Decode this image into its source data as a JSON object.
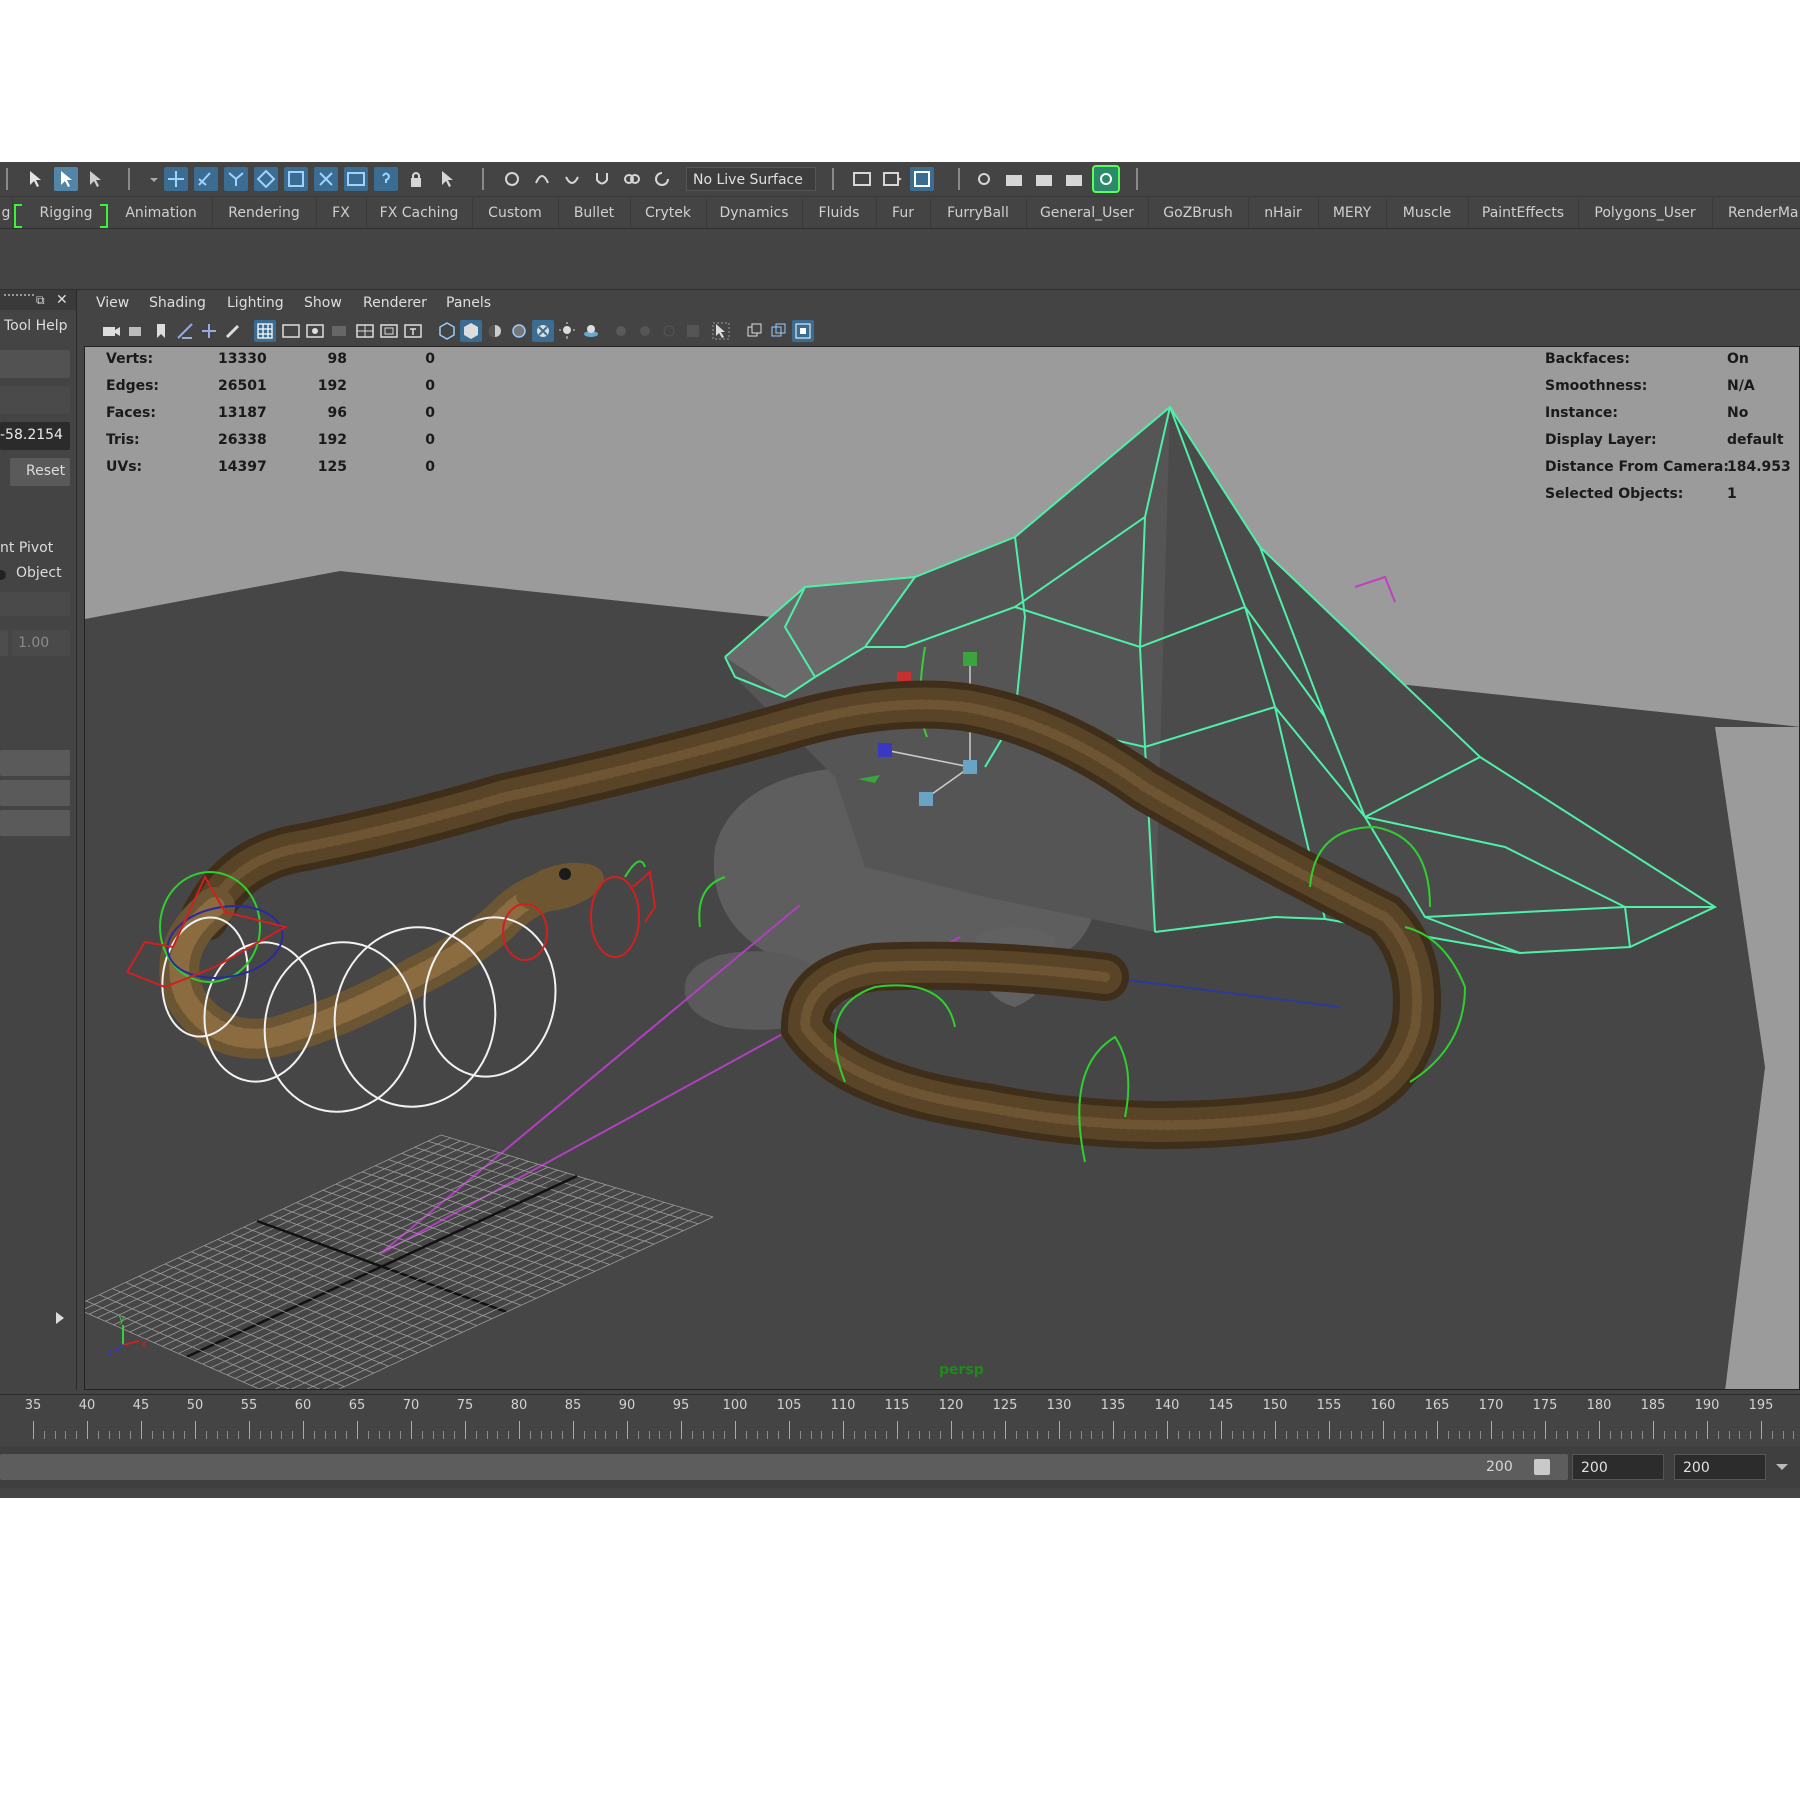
{
  "toolbar": {
    "live_surface_label": "No Live Surface"
  },
  "shelf": {
    "tabs": [
      "g",
      "Rigging",
      "Animation",
      "Rendering",
      "FX",
      "FX Caching",
      "Custom",
      "Bullet",
      "Crytek",
      "Dynamics",
      "Fluids",
      "Fur",
      "FurryBall",
      "General_User",
      "GoZBrush",
      "nHair",
      "MERY",
      "Muscle",
      "PaintEffects",
      "Polygons_User",
      "RenderMa"
    ],
    "active_tab": "Rigging"
  },
  "left_panel": {
    "header_label": "Tool Help",
    "coord_value": "-58.2154",
    "reset_label": "Reset",
    "pivot_label": "nt Pivot",
    "object_option_label": "Object",
    "weight_value": "1.00"
  },
  "viewport": {
    "menu": [
      "View",
      "Shading",
      "Lighting",
      "Show",
      "Renderer",
      "Panels"
    ],
    "camera_label": "persp",
    "hud_left": [
      {
        "label": "Verts:",
        "values": [
          "13330",
          "98",
          "0"
        ]
      },
      {
        "label": "Edges:",
        "values": [
          "26501",
          "192",
          "0"
        ]
      },
      {
        "label": "Faces:",
        "values": [
          "13187",
          "96",
          "0"
        ]
      },
      {
        "label": "Tris:",
        "values": [
          "26338",
          "192",
          "0"
        ]
      },
      {
        "label": "UVs:",
        "values": [
          "14397",
          "125",
          "0"
        ]
      }
    ],
    "hud_right": [
      {
        "label": "Backfaces:",
        "value": "On"
      },
      {
        "label": "Smoothness:",
        "value": "N/A"
      },
      {
        "label": "Instance:",
        "value": "No"
      },
      {
        "label": "Display Layer:",
        "value": "default"
      },
      {
        "label": "Distance From Camera:",
        "value": "184.953"
      },
      {
        "label": "Selected Objects:",
        "value": "1"
      }
    ],
    "axis_labels": {
      "y": "y",
      "z": "z",
      "x": "x"
    }
  },
  "timeline": {
    "ticks": [
      "35",
      "40",
      "45",
      "50",
      "55",
      "60",
      "65",
      "70",
      "75",
      "80",
      "85",
      "90",
      "95",
      "100",
      "105",
      "110",
      "115",
      "120",
      "125",
      "130",
      "135",
      "140",
      "145",
      "150",
      "155",
      "160",
      "165",
      "170",
      "175",
      "180",
      "185",
      "190",
      "195"
    ]
  },
  "range": {
    "slider_end": "200",
    "end_field": "200",
    "max_field": "200"
  },
  "colors": {
    "wireframe": "#4ef0a8",
    "snake": "#4f3b22",
    "rock": "#5a5a5a",
    "ground": "#464646",
    "sky": "#9b9b9b"
  }
}
